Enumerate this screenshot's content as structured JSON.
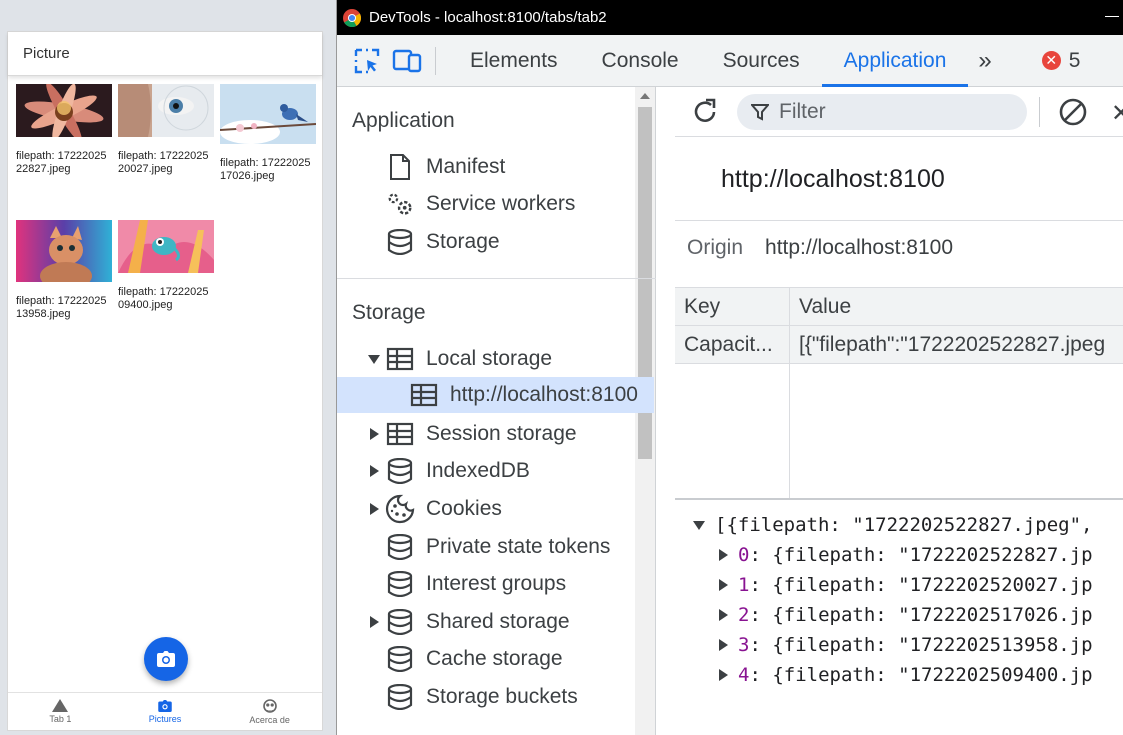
{
  "app": {
    "header_title": "Picture",
    "photos": [
      {
        "caption": "filepath: 1722202522827.jpeg"
      },
      {
        "caption": "filepath: 1722202520027.jpeg"
      },
      {
        "caption": "filepath: 1722202517026.jpeg"
      },
      {
        "caption": "filepath: 1722202513958.jpeg"
      },
      {
        "caption": "filepath: 1722202509400.jpeg"
      }
    ],
    "tabs": [
      {
        "label": "Tab 1",
        "icon": "triangle-icon"
      },
      {
        "label": "Pictures",
        "icon": "camera-icon"
      },
      {
        "label": "Acerca de",
        "icon": "skull-icon"
      }
    ]
  },
  "devtools": {
    "window_title": "DevTools - localhost:8100/tabs/tab2",
    "panel_tabs": [
      "Elements",
      "Console",
      "Sources",
      "Application"
    ],
    "active_tab": "Application",
    "error_count": "5",
    "sidebar": {
      "application_title": "Application",
      "application_items": [
        "Manifest",
        "Service workers",
        "Storage"
      ],
      "storage_title": "Storage",
      "storage_items": [
        "Local storage",
        "http://localhost:8100",
        "Session storage",
        "IndexedDB",
        "Cookies",
        "Private state tokens",
        "Interest groups",
        "Shared storage",
        "Cache storage",
        "Storage buckets"
      ]
    },
    "main": {
      "filter_placeholder": "Filter",
      "origin_heading": "http://localhost:8100",
      "origin_label": "Origin",
      "origin_value": "http://localhost:8100",
      "table_headers": [
        "Key",
        "Value"
      ],
      "rows": [
        {
          "key": "Capacit...",
          "value": "[{\"filepath\":\"1722202522827.jpeg"
        }
      ],
      "preview_root": "[{filepath: \"1722202522827.jpeg\",",
      "preview_items": [
        {
          "index": "0",
          "text": ": {filepath: \"1722202522827.jp"
        },
        {
          "index": "1",
          "text": ": {filepath: \"1722202520027.jp"
        },
        {
          "index": "2",
          "text": ": {filepath: \"1722202517026.jp"
        },
        {
          "index": "3",
          "text": ": {filepath: \"1722202513958.jp"
        },
        {
          "index": "4",
          "text": ": {filepath: \"1722202509400.jp"
        }
      ]
    }
  }
}
